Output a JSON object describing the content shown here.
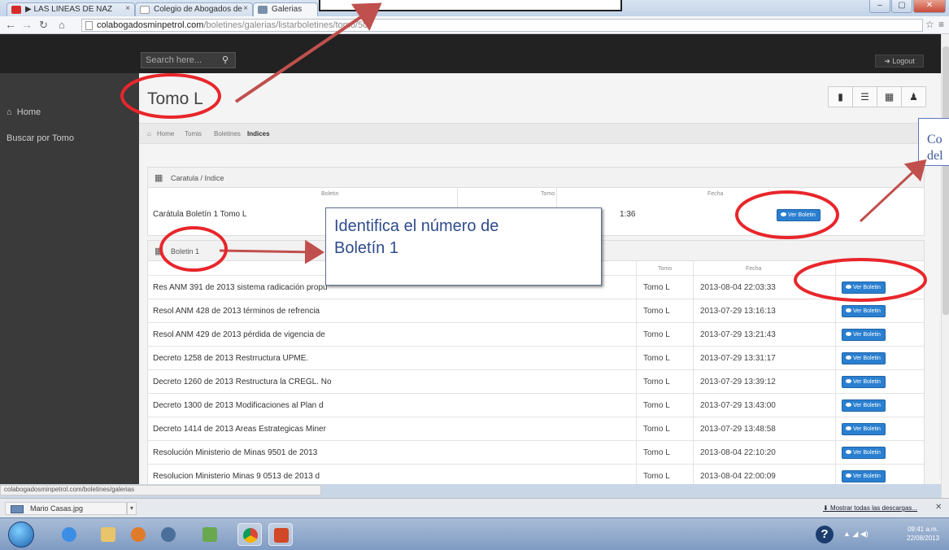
{
  "browser": {
    "tabs": [
      {
        "label": "▶ LAS LINEAS DE NAZ"
      },
      {
        "label": "Colegio de Abogados de"
      },
      {
        "label": "Galerias"
      }
    ],
    "url_host": "colabogadosminpetrol.com",
    "url_path": "/boletines/galerias/listarboletines/tomo/50",
    "status_url": "colabogadosminpetrol.com/boletines/galerias"
  },
  "app": {
    "search_placeholder": "Search here...",
    "logout_label": "Logout",
    "page_title": "Tomo L",
    "sidebar": [
      {
        "label": "Home"
      },
      {
        "label": "Buscar por Tomo"
      }
    ],
    "breadcrumb": [
      "Home",
      "Tomis",
      "Boletines",
      "Indices"
    ]
  },
  "caratula_panel": {
    "title": "Caratula / Indice",
    "headers": {
      "boletin": "Boletin",
      "tomo": "Tomo",
      "fecha": "Fecha"
    },
    "row": {
      "name": "Carátula Boletín 1 Tomo L",
      "fecha_partial": "1:36",
      "button": "Ver Boletin"
    }
  },
  "boletin_panel": {
    "title": "Boletin 1",
    "headers": {
      "tomo": "Tomo",
      "fecha": "Fecha"
    },
    "rows": [
      {
        "name": "Res ANM 391 de 2013 sistema radicación propu",
        "tomo": "Tomo L",
        "fecha": "2013-08-04 22:03:33",
        "button": "Ver Boletin"
      },
      {
        "name": "Resol ANM 428 de 2013 términos de refrencia",
        "tomo": "Tomo L",
        "fecha": "2013-07-29 13:16:13",
        "button": "Ver Boletin"
      },
      {
        "name": "Resol ANM 429 de 2013 pérdida de vigencia de",
        "tomo": "Tomo L",
        "fecha": "2013-07-29 13:21:43",
        "button": "Ver Boletin"
      },
      {
        "name": "Decreto 1258 de 2013 Restrructura UPME.",
        "tomo": "Tomo L",
        "fecha": "2013-07-29 13:31:17",
        "button": "Ver Boletin"
      },
      {
        "name": "Decreto 1260 de 2013 Restructura la CREGL. No",
        "tomo": "Tomo L",
        "fecha": "2013-07-29 13:39:12",
        "button": "Ver Boletin"
      },
      {
        "name": "Decreto 1300 de 2013 Modificaciones al Plan d",
        "tomo": "Tomo L",
        "fecha": "2013-07-29 13:43:00",
        "button": "Ver Boletin"
      },
      {
        "name": "Decreto 1414 de 2013 Areas Estrategicas Miner",
        "tomo": "Tomo L",
        "fecha": "2013-07-29 13:48:58",
        "button": "Ver Boletin"
      },
      {
        "name": "Resolución Ministerio de Minas 9501 de 2013",
        "tomo": "Tomo L",
        "fecha": "2013-08-04 22:10:20",
        "button": "Ver Boletin"
      },
      {
        "name": "Resolucion Ministerio Minas 9 0513 de 2013 d",
        "tomo": "Tomo L",
        "fecha": "2013-08-04 22:00:09",
        "button": "Ver Boletin"
      }
    ]
  },
  "annotations": {
    "boletin_line1": "Identifica el número de",
    "boletin_line2": "Boletín 1",
    "right_line1": "Co",
    "right_line2": "del",
    "accent_color": "#e8262b",
    "arrow_color": "#c0504d"
  },
  "downloads": {
    "file": "Mario Casas.jpg",
    "show_all": "Mostrar todas las descargas..."
  },
  "taskbar": {
    "time": "09:41 a.m.",
    "date": "22/08/2013"
  }
}
